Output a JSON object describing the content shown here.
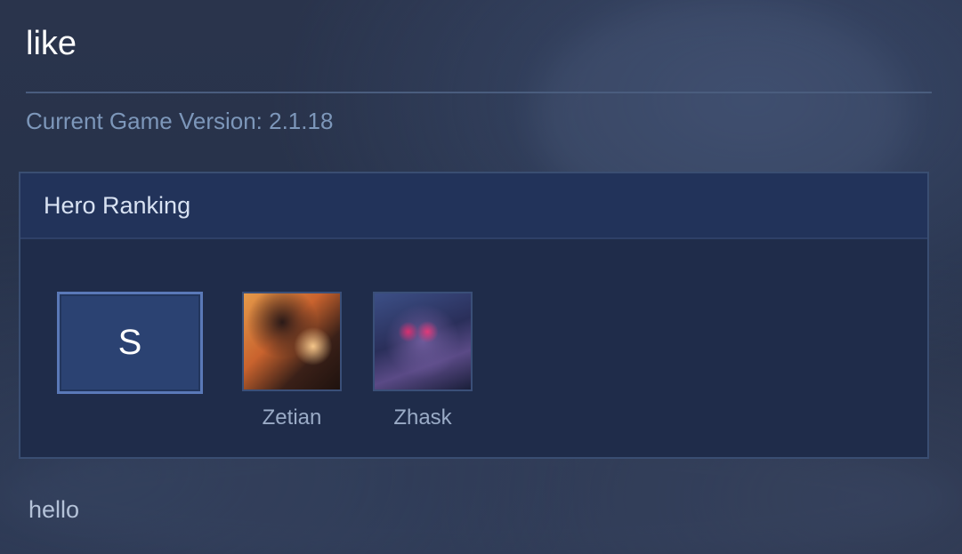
{
  "page": {
    "title": "like",
    "version_text": "Current Game Version: 2.1.18",
    "footer_text": "hello"
  },
  "ranking": {
    "header": "Hero Ranking",
    "tier": "S",
    "heroes": [
      {
        "name": "Zetian",
        "icon": "zetian-portrait"
      },
      {
        "name": "Zhask",
        "icon": "zhask-portrait"
      }
    ]
  },
  "colors": {
    "background": "#27324a",
    "panel": "#1f2c4a",
    "tier_badge": "#2b4272",
    "accent_border": "#5a79b8",
    "version_text": "#7d97ba"
  }
}
